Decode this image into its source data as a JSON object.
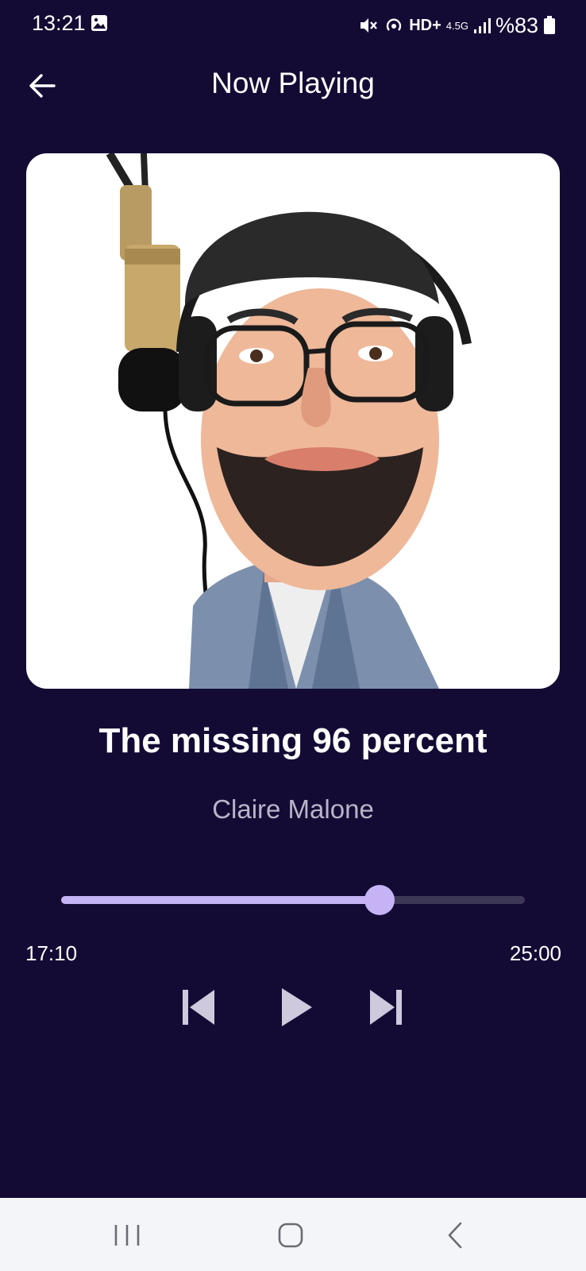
{
  "status_bar": {
    "time": "13:21",
    "network_hd": "HD+",
    "network_type": "4.5G",
    "battery_text": "%83"
  },
  "header": {
    "title": "Now Playing"
  },
  "track": {
    "title": "The missing 96 percent",
    "artist": "Claire Malone"
  },
  "progress": {
    "elapsed": "17:10",
    "total": "25:00",
    "fraction": 0.687
  },
  "icons": {
    "back": "back-arrow-icon",
    "previous": "skip-previous-icon",
    "play": "play-icon",
    "next": "skip-next-icon"
  },
  "colors": {
    "background": "#140b35",
    "accent": "#c5b3f5",
    "track_inactive": "#3d3855",
    "artist_text": "#b9b4c8",
    "nav_bar": "#f4f5f9"
  }
}
